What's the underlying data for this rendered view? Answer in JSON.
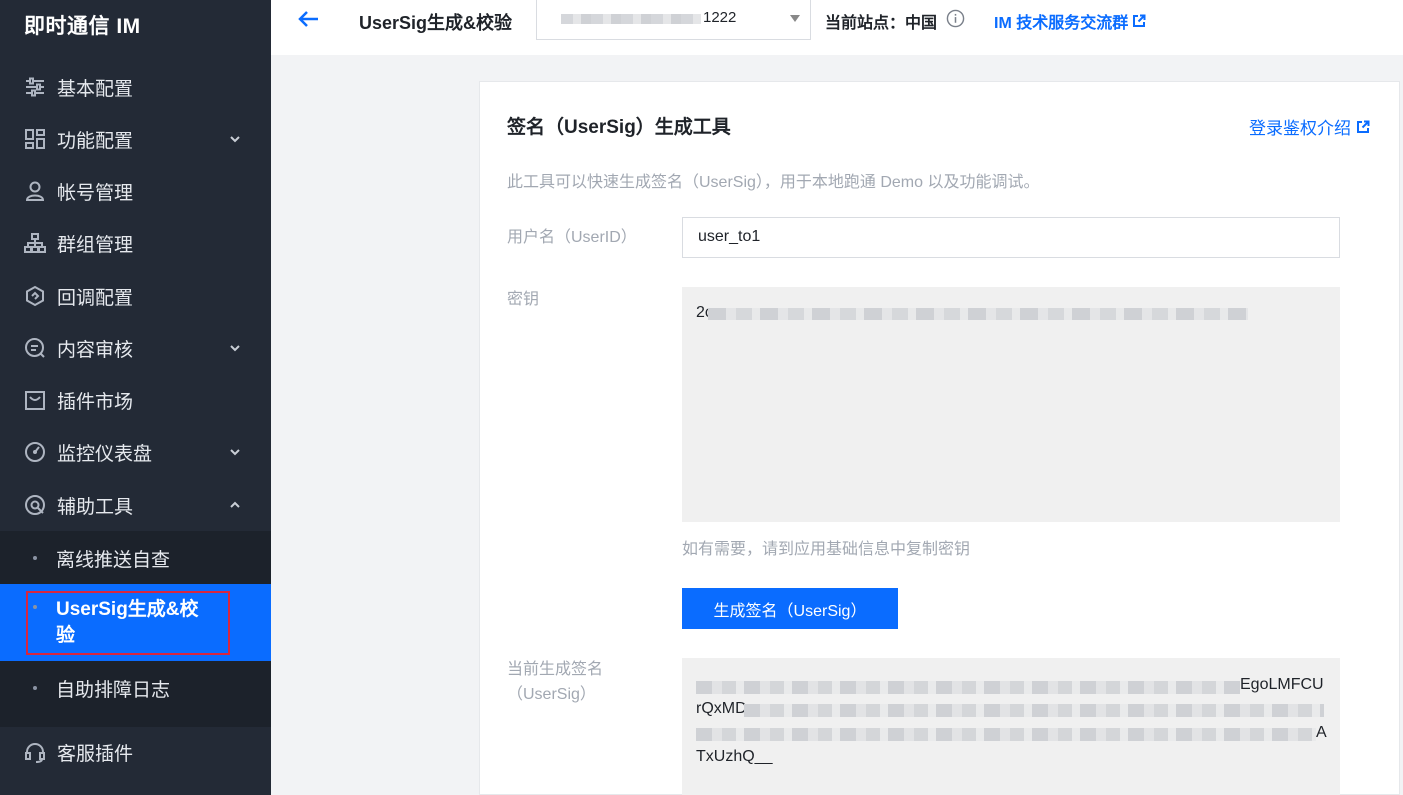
{
  "sidebar": {
    "brand": "即时通信 IM",
    "items": [
      {
        "label": "基本配置",
        "icon": "sliders-icon"
      },
      {
        "label": "功能配置",
        "icon": "grid-icon"
      },
      {
        "label": "帐号管理",
        "icon": "user-icon"
      },
      {
        "label": "群组管理",
        "icon": "org-tree-icon"
      },
      {
        "label": "回调配置",
        "icon": "callback-icon"
      },
      {
        "label": "内容审核",
        "icon": "audit-icon"
      },
      {
        "label": "插件市场",
        "icon": "store-icon"
      },
      {
        "label": "监控仪表盘",
        "icon": "gauge-icon"
      },
      {
        "label": "辅助工具",
        "icon": "tools-icon"
      }
    ],
    "subitems": [
      {
        "label": "离线推送自查"
      },
      {
        "label": "UserSig生成&校\n验"
      },
      {
        "label": "自助排障日志"
      }
    ],
    "support": {
      "label": "客服插件",
      "icon": "headset-icon"
    }
  },
  "header": {
    "title": "UserSig生成&校验",
    "app_select_value": "1222",
    "site_label": "当前站点：中国",
    "group_link": "IM 技术服务交流群"
  },
  "card": {
    "title": "签名（UserSig）生成工具",
    "doc_link": "登录鉴权介绍",
    "description": "此工具可以快速生成签名（UserSig），用于本地跑通 Demo 以及功能调试。",
    "userid_label": "用户名（UserID）",
    "userid_value": "user_to1",
    "key_label": "密钥",
    "key_prefix": "2c",
    "key_hint": "如有需要，请到应用基础信息中复制密钥",
    "generate_button": "生成签名（UserSig）",
    "sig_label_1": "当前生成签名",
    "sig_label_2": "（UserSig）",
    "sig_line1_end": "EgoLMFCU",
    "sig_line2_start": "rQxMD",
    "sig_line3_end": "A",
    "sig_line4": "TxUzhQ__"
  },
  "colors": {
    "sidebar_bg": "#232a36",
    "active": "#0a6cff",
    "highlight_border": "#d8263f"
  }
}
